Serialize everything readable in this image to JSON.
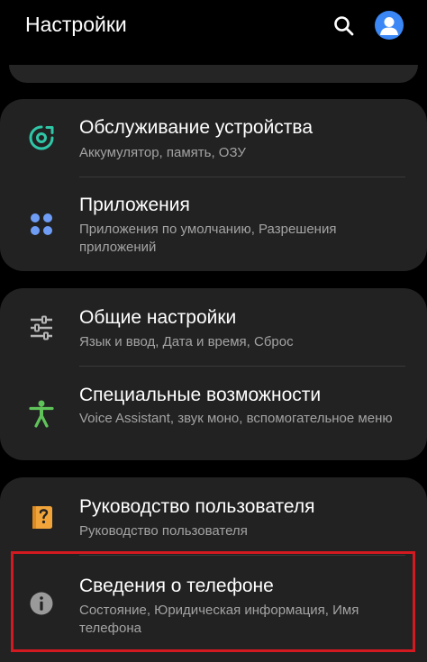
{
  "header": {
    "title": "Настройки",
    "search_icon": "search-icon",
    "avatar_icon": "account-icon"
  },
  "colors": {
    "background": "#000000",
    "card": "#222222",
    "accent_blue": "#3b87f5",
    "teal": "#2fc7a8",
    "green": "#5fc35a",
    "orange": "#f0a43a",
    "highlight_red": "#d21a20"
  },
  "groups": [
    {
      "items": [
        {
          "icon": "device-care-icon",
          "label": "Обслуживание устройства",
          "subtitle": "Аккумулятор, память, ОЗУ"
        },
        {
          "icon": "apps-icon",
          "label": "Приложения",
          "subtitle": "Приложения по умолчанию, Разрешения приложений"
        }
      ]
    },
    {
      "items": [
        {
          "icon": "sliders-icon",
          "label": "Общие настройки",
          "subtitle": "Язык и ввод, Дата и время, Сброс"
        },
        {
          "icon": "accessibility-icon",
          "label": "Специальные возможности",
          "subtitle": "Voice Assistant, звук моно, вспомогательное меню"
        }
      ]
    },
    {
      "items": [
        {
          "icon": "user-manual-icon",
          "label": "Руководство пользователя",
          "subtitle": "Руководство пользователя"
        },
        {
          "icon": "info-icon",
          "label": "Сведения о телефоне",
          "subtitle": "Состояние, Юридическая информация, Имя телефона"
        }
      ]
    }
  ]
}
